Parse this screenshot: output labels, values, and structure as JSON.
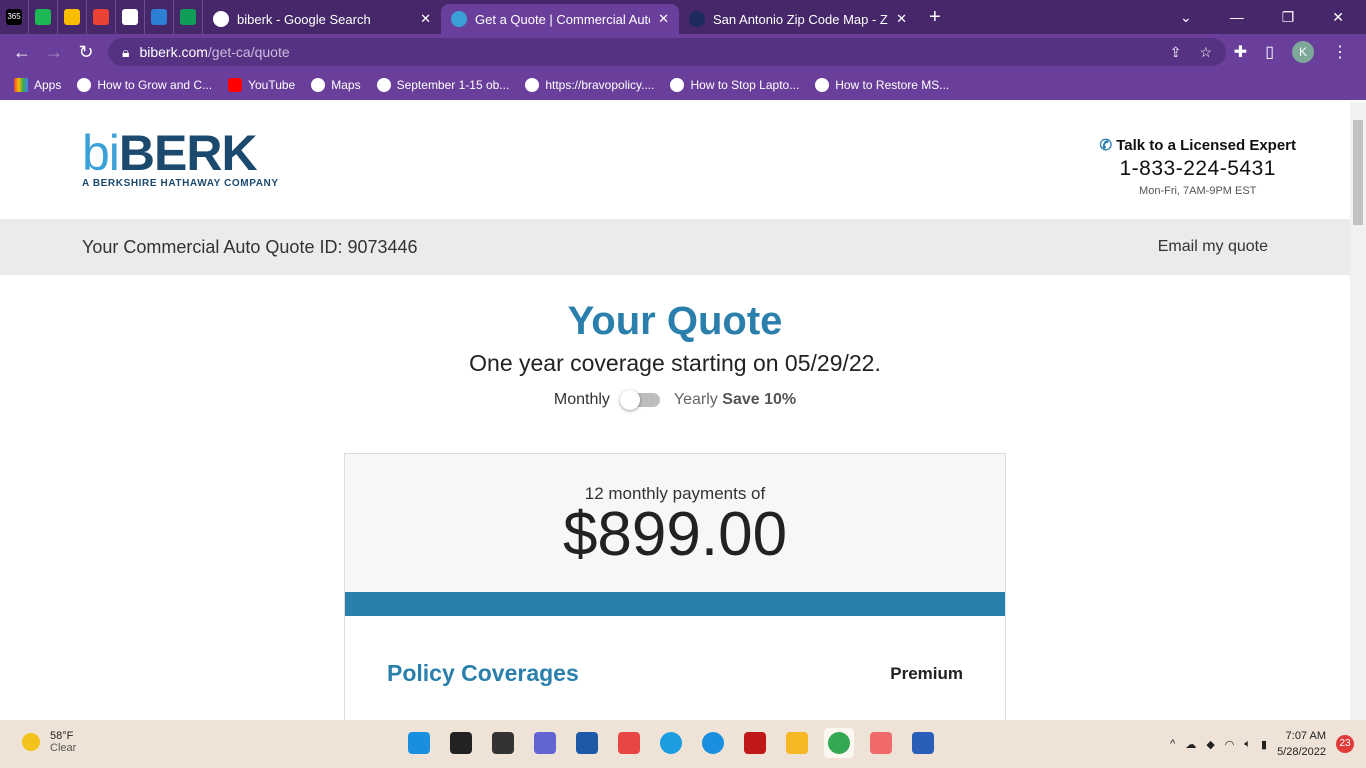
{
  "browser": {
    "pinned_tabs": [
      {
        "icon": "office-365-icon",
        "color": "#000000",
        "label": "365"
      },
      {
        "icon": "spotify-icon",
        "color": "#1db954"
      },
      {
        "icon": "google-drive-icon",
        "color": "#fbbc04"
      },
      {
        "icon": "gmail-icon",
        "color": "#ea4335"
      },
      {
        "icon": "globe-icon",
        "color": "#ffffff"
      },
      {
        "icon": "cortana-icon",
        "color": "#2d7fd6"
      },
      {
        "icon": "google-classroom-icon",
        "color": "#0f9d58"
      }
    ],
    "tabs": [
      {
        "title": "biberk - Google Search",
        "icon": "google-icon",
        "active": false
      },
      {
        "title": "Get a Quote | Commercial Auto |",
        "icon": "biberk-icon",
        "active": true
      },
      {
        "title": "San Antonio Zip Code Map - Zipc",
        "icon": "zipcode-icon",
        "active": false
      }
    ],
    "url_host": "biberk.com",
    "url_path": "/get-ca/quote",
    "profile_initial": "K",
    "bookmarks": [
      {
        "label": "Apps",
        "icon": "apps-grid-icon"
      },
      {
        "label": "How to Grow and C...",
        "icon": "site-icon"
      },
      {
        "label": "YouTube",
        "icon": "youtube-icon"
      },
      {
        "label": "Maps",
        "icon": "globe-icon"
      },
      {
        "label": "September 1-15 ob...",
        "icon": "globe-icon"
      },
      {
        "label": "https://bravopolicy....",
        "icon": "globe-icon"
      },
      {
        "label": "How to Stop Lapto...",
        "icon": "hp-icon"
      },
      {
        "label": "How to Restore MS...",
        "icon": "site-icon"
      }
    ]
  },
  "site": {
    "logo": {
      "bi": "bi",
      "berk": "BERK",
      "tagline": "A BERKSHIRE HATHAWAY COMPANY"
    },
    "contact": {
      "talk": "Talk to a Licensed Expert",
      "phone": "1-833-224-5431",
      "hours": "Mon-Fri, 7AM-9PM EST"
    },
    "quote_id_label": "Your Commercial Auto Quote ID: 9073446",
    "email_link": "Email my quote",
    "title": "Your Quote",
    "subtitle": "One year coverage starting on 05/29/22.",
    "toggle": {
      "monthly": "Monthly",
      "yearly": "Yearly",
      "save": "Save 10%",
      "selected": "Monthly"
    },
    "payment_label": "12 monthly payments of",
    "payment_amount": "$899.00",
    "coverages_heading": "Policy Coverages",
    "premium_heading": "Premium",
    "accent_color": "#2a7fac"
  },
  "taskbar": {
    "weather_temp": "58°F",
    "weather_cond": "Clear",
    "apps": [
      {
        "icon": "windows-start-icon",
        "color": "#1a8fe0"
      },
      {
        "icon": "search-icon",
        "color": "#222222"
      },
      {
        "icon": "task-view-icon",
        "color": "#333333"
      },
      {
        "icon": "teams-chat-icon",
        "color": "#6264d3"
      },
      {
        "icon": "microsoft-store-icon",
        "color": "#1c5aa8"
      },
      {
        "icon": "app-red-icon",
        "color": "#e84545"
      },
      {
        "icon": "edge-icon",
        "color": "#1b9de2"
      },
      {
        "icon": "help-icon",
        "color": "#1a8fe0"
      },
      {
        "icon": "mcafee-icon",
        "color": "#c01818"
      },
      {
        "icon": "file-explorer-icon",
        "color": "#f3b824"
      },
      {
        "icon": "chrome-icon",
        "color": "#34a853"
      },
      {
        "icon": "asana-icon",
        "color": "#f06a6a"
      },
      {
        "icon": "word-icon",
        "color": "#2b5eb8"
      }
    ],
    "time": "7:07 AM",
    "date": "5/28/2022",
    "notifications": "23"
  }
}
